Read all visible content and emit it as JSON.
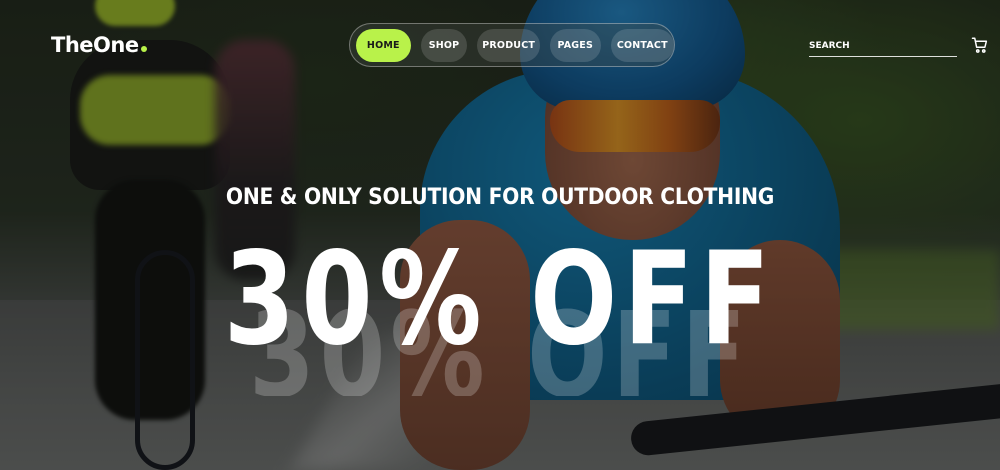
{
  "header": {
    "logo_text": "TheOne",
    "nav": [
      {
        "label": "HOME",
        "active": true
      },
      {
        "label": "SHOP",
        "active": false
      },
      {
        "label": "PRODUCT",
        "active": false
      },
      {
        "label": "PAGES",
        "active": false
      },
      {
        "label": "CONTACT",
        "active": false
      }
    ],
    "search": {
      "placeholder": "SEARCH",
      "value": ""
    },
    "cart_icon": "shopping-cart-icon"
  },
  "hero": {
    "tagline": "ONE & ONLY SOLUTION FOR OUTDOOR CLOTHING",
    "headline": "30% OFF",
    "headline_ghost": "30% OFF"
  },
  "colors": {
    "accent": "#b9f24a",
    "text": "#ffffff"
  }
}
